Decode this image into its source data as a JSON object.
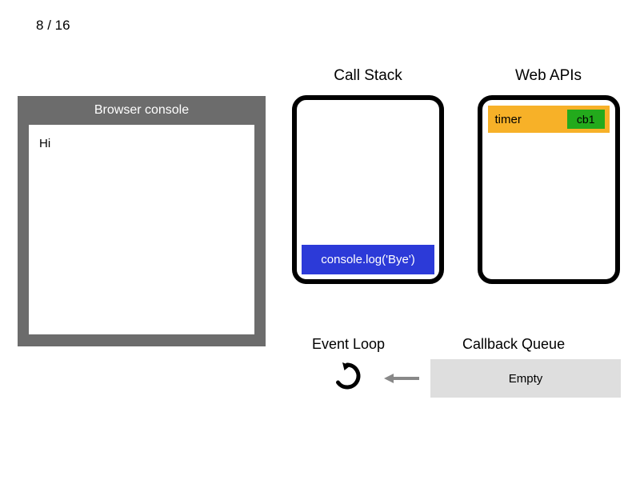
{
  "page": {
    "current": 8,
    "total": 16
  },
  "browser": {
    "title": "Browser console",
    "console_lines": [
      "Hi"
    ]
  },
  "call_stack": {
    "label": "Call Stack",
    "frames": [
      "console.log('Bye')"
    ]
  },
  "web_apis": {
    "label": "Web APIs",
    "items": [
      {
        "label": "timer",
        "callback": "cb1"
      }
    ]
  },
  "event_loop": {
    "label": "Event Loop"
  },
  "callback_queue": {
    "label": "Callback Queue",
    "content": "Empty"
  },
  "colors": {
    "panel_gray": "#6c6c6c",
    "frame_blue": "#2c3ad8",
    "api_orange": "#f7b128",
    "cb_green": "#23aa1c",
    "queue_gray": "#dedede"
  }
}
